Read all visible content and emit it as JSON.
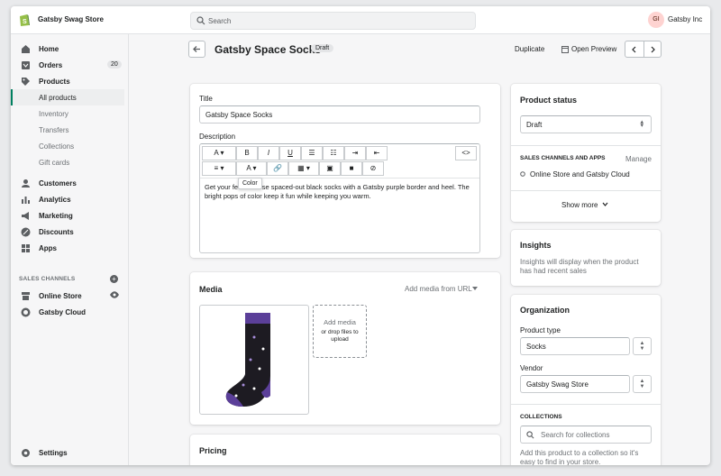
{
  "topbar": {
    "store_name": "Gatsby Swag Store",
    "search_placeholder": "Search",
    "avatar_initials": "GI",
    "account_name": "Gatsby Inc"
  },
  "sidebar": {
    "items": [
      {
        "label": "Home",
        "icon": "home-icon"
      },
      {
        "label": "Orders",
        "icon": "orders-icon",
        "count": "20"
      },
      {
        "label": "Products",
        "icon": "tag-icon"
      },
      {
        "label": "All products",
        "active": true
      },
      {
        "label": "Inventory"
      },
      {
        "label": "Transfers"
      },
      {
        "label": "Collections"
      },
      {
        "label": "Gift cards"
      },
      {
        "label": "Customers",
        "icon": "person-icon"
      },
      {
        "label": "Analytics",
        "icon": "bar-chart-icon"
      },
      {
        "label": "Marketing",
        "icon": "megaphone-icon"
      },
      {
        "label": "Discounts",
        "icon": "discount-icon"
      },
      {
        "label": "Apps",
        "icon": "apps-icon"
      }
    ],
    "sales_channels_heading": "SALES CHANNELS",
    "channels": [
      {
        "label": "Online Store"
      },
      {
        "label": "Gatsby Cloud"
      }
    ],
    "settings_label": "Settings"
  },
  "page": {
    "title": "Gatsby Space Socks",
    "status_badge": "Draft",
    "duplicate_label": "Duplicate",
    "preview_label": "Open Preview"
  },
  "details": {
    "title_label": "Title",
    "title_value": "Gatsby Space Socks",
    "description_label": "Description",
    "tooltip": "Color",
    "description_text": "Get your feet in these spaced-out black socks with a Gatsby purple border and heel. The bright pops of color keep it fun while keeping you warm.",
    "toolbar_row1": [
      "A ▾",
      "B",
      "I",
      "U",
      "☰",
      "☷",
      "⇥",
      "⇤"
    ],
    "toolbar_row2": [
      "≡ ▾",
      "A ▾",
      "🔗",
      "▦ ▾",
      "▣",
      "■",
      "⊘"
    ],
    "code_btn": "<>"
  },
  "media": {
    "title": "Media",
    "add_from_url": "Add media from URL",
    "drop_title": "Add media",
    "drop_hint": "or drop files to upload"
  },
  "pricing": {
    "title": "Pricing"
  },
  "status_card": {
    "title": "Product status",
    "status_value": "Draft",
    "channels_heading": "SALES CHANNELS AND APPS",
    "manage_label": "Manage",
    "channel_line": "Online Store and Gatsby Cloud",
    "show_more": "Show more"
  },
  "insights": {
    "title": "Insights",
    "text": "Insights will display when the product has had recent sales"
  },
  "organization": {
    "title": "Organization",
    "product_type_label": "Product type",
    "product_type_value": "Socks",
    "vendor_label": "Vendor",
    "vendor_value": "Gatsby Swag Store",
    "collections_heading": "COLLECTIONS",
    "collections_placeholder": "Search for collections",
    "collections_help": "Add this product to a collection so it's easy to find in your store."
  },
  "colors": {
    "accent": "#008060",
    "sock_purple": "#5b3f99",
    "badge_bg": "#e4e5e7"
  }
}
